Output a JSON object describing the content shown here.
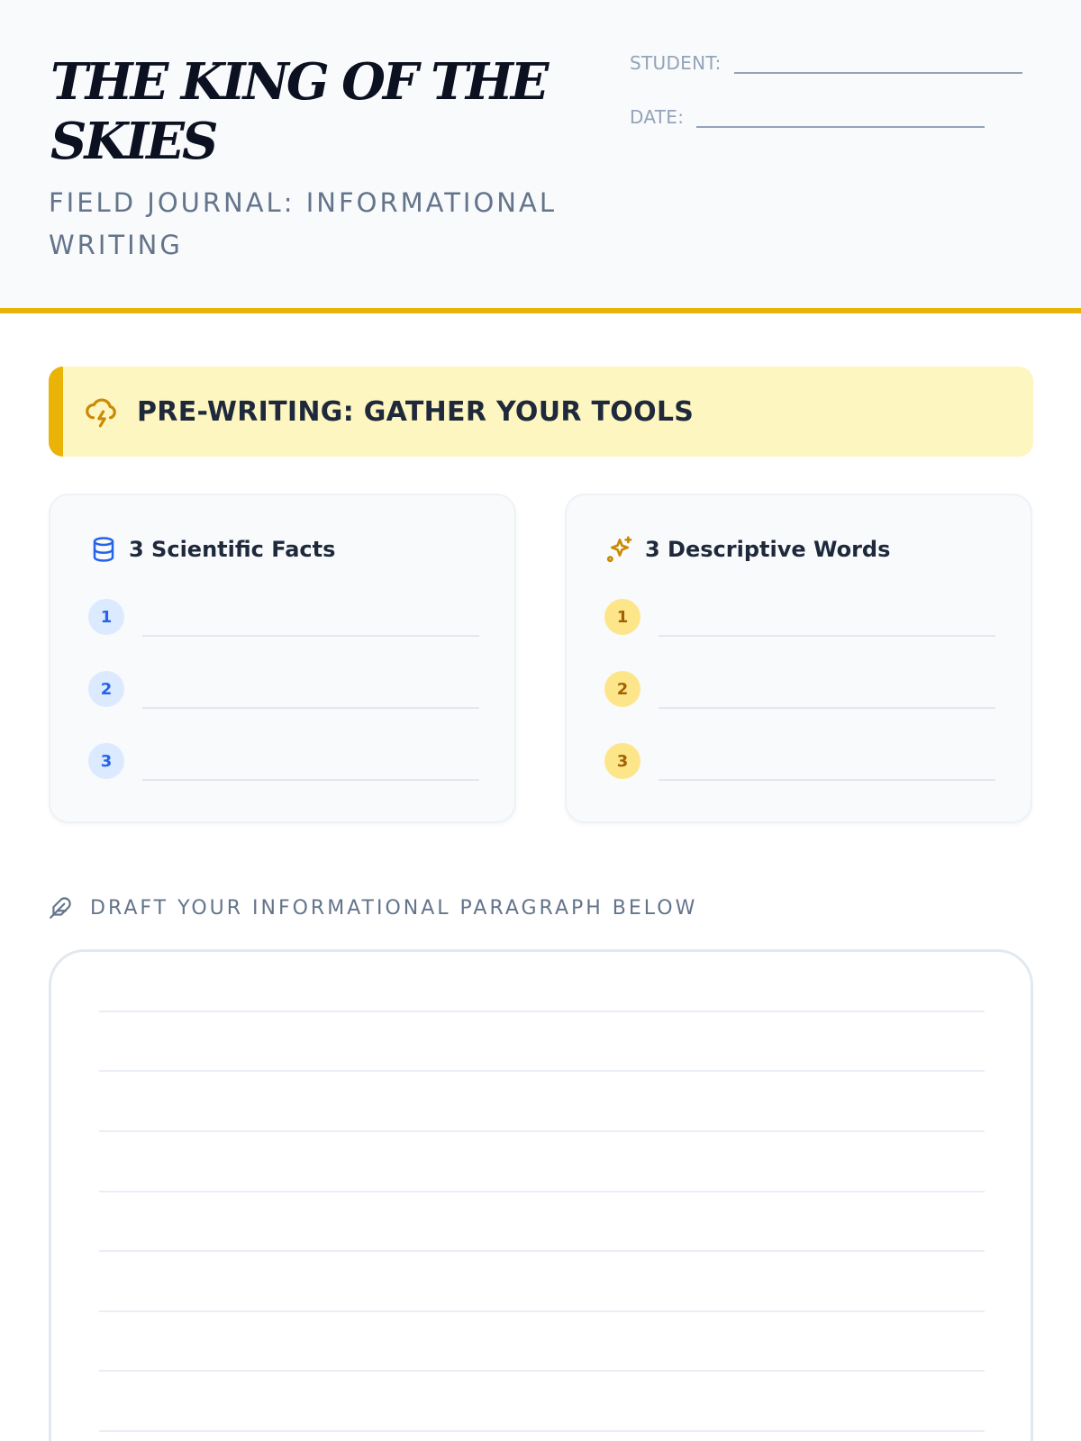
{
  "header": {
    "title": "THE KING OF THE SKIES",
    "subtitle": "FIELD JOURNAL: INFORMATIONAL WRITING",
    "student_label": "STUDENT:",
    "date_label": "DATE:"
  },
  "banner": {
    "icon": "storm-cloud-icon",
    "text": "PRE-WRITING: GATHER YOUR TOOLS"
  },
  "facts_card": {
    "icon": "database-icon",
    "title": "3 Scientific Facts",
    "items": [
      "1",
      "2",
      "3"
    ]
  },
  "words_card": {
    "icon": "sparkles-icon",
    "title": "3 Descriptive Words",
    "items": [
      "1",
      "2",
      "3"
    ]
  },
  "draft": {
    "icon": "feather-icon",
    "label": "DRAFT YOUR INFORMATIONAL PARAGRAPH BELOW"
  },
  "colors": {
    "accent": "#eab308",
    "banner_bg": "#fef6c0",
    "blue": "#2563eb",
    "muted": "#64748b"
  }
}
